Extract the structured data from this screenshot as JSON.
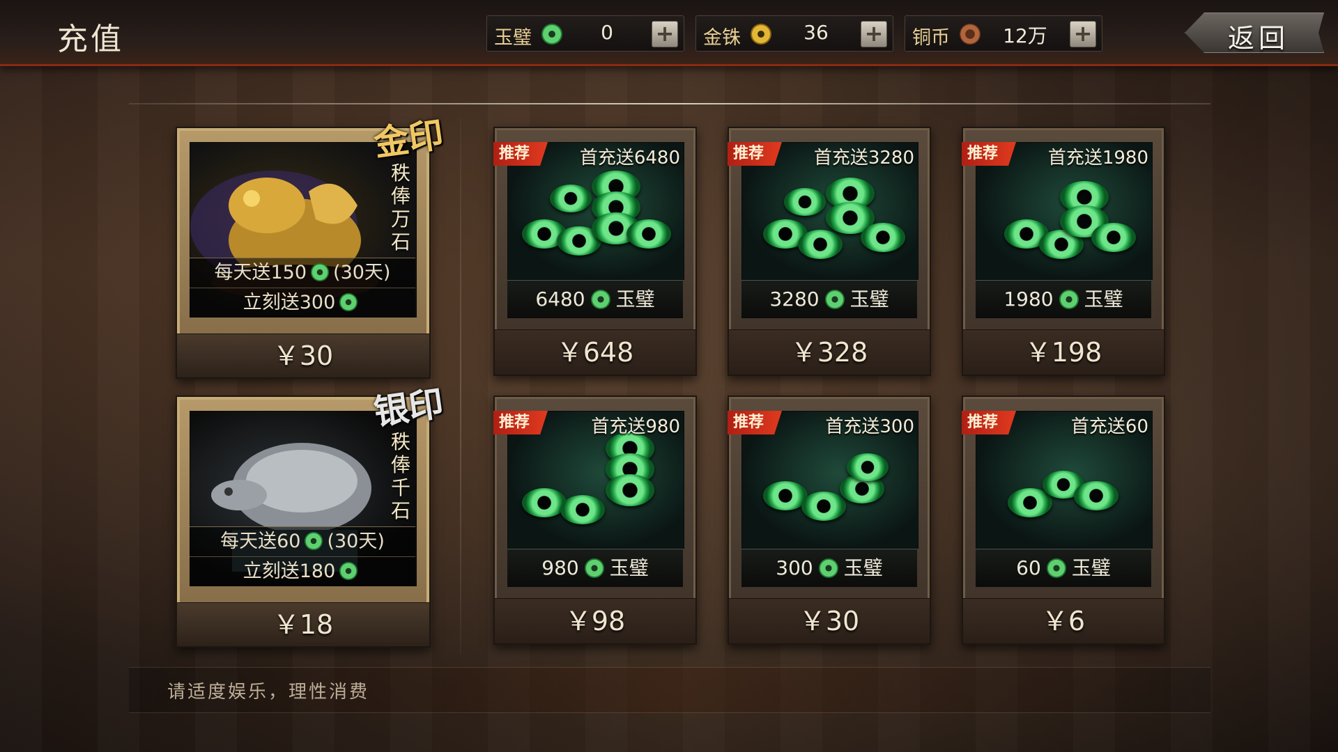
{
  "header": {
    "title": "充值",
    "back_label": "返回",
    "currencies": [
      {
        "label": "玉璧",
        "value": "0",
        "icon": "jade-coin-icon"
      },
      {
        "label": "金铢",
        "value": "36",
        "icon": "gold-coin-icon"
      },
      {
        "label": "铜币",
        "value": "12万",
        "icon": "copper-coin-icon"
      }
    ]
  },
  "subscriptions": [
    {
      "seal": "金印",
      "motto": "秩俸万石",
      "daily": "每天送150",
      "daily_suffix": "(30天)",
      "instant": "立刻送300",
      "price": "￥30"
    },
    {
      "seal": "银印",
      "motto": "秩俸千石",
      "daily": "每天送60",
      "daily_suffix": "(30天)",
      "instant": "立刻送180",
      "price": "￥18"
    }
  ],
  "packs": [
    {
      "tag": "推荐",
      "bonus": "首充送6480",
      "amount": "6480",
      "unit": "玉璧",
      "price": "￥648"
    },
    {
      "tag": "推荐",
      "bonus": "首充送3280",
      "amount": "3280",
      "unit": "玉璧",
      "price": "￥328"
    },
    {
      "tag": "推荐",
      "bonus": "首充送1980",
      "amount": "1980",
      "unit": "玉璧",
      "price": "￥198"
    },
    {
      "tag": "推荐",
      "bonus": "首充送980",
      "amount": "980",
      "unit": "玉璧",
      "price": "￥98"
    },
    {
      "tag": "推荐",
      "bonus": "首充送300",
      "amount": "300",
      "unit": "玉璧",
      "price": "￥30"
    },
    {
      "tag": "推荐",
      "bonus": "首充送60",
      "amount": "60",
      "unit": "玉璧",
      "price": "￥6"
    }
  ],
  "footer": {
    "notice": "请适度娱乐，理性消费"
  }
}
